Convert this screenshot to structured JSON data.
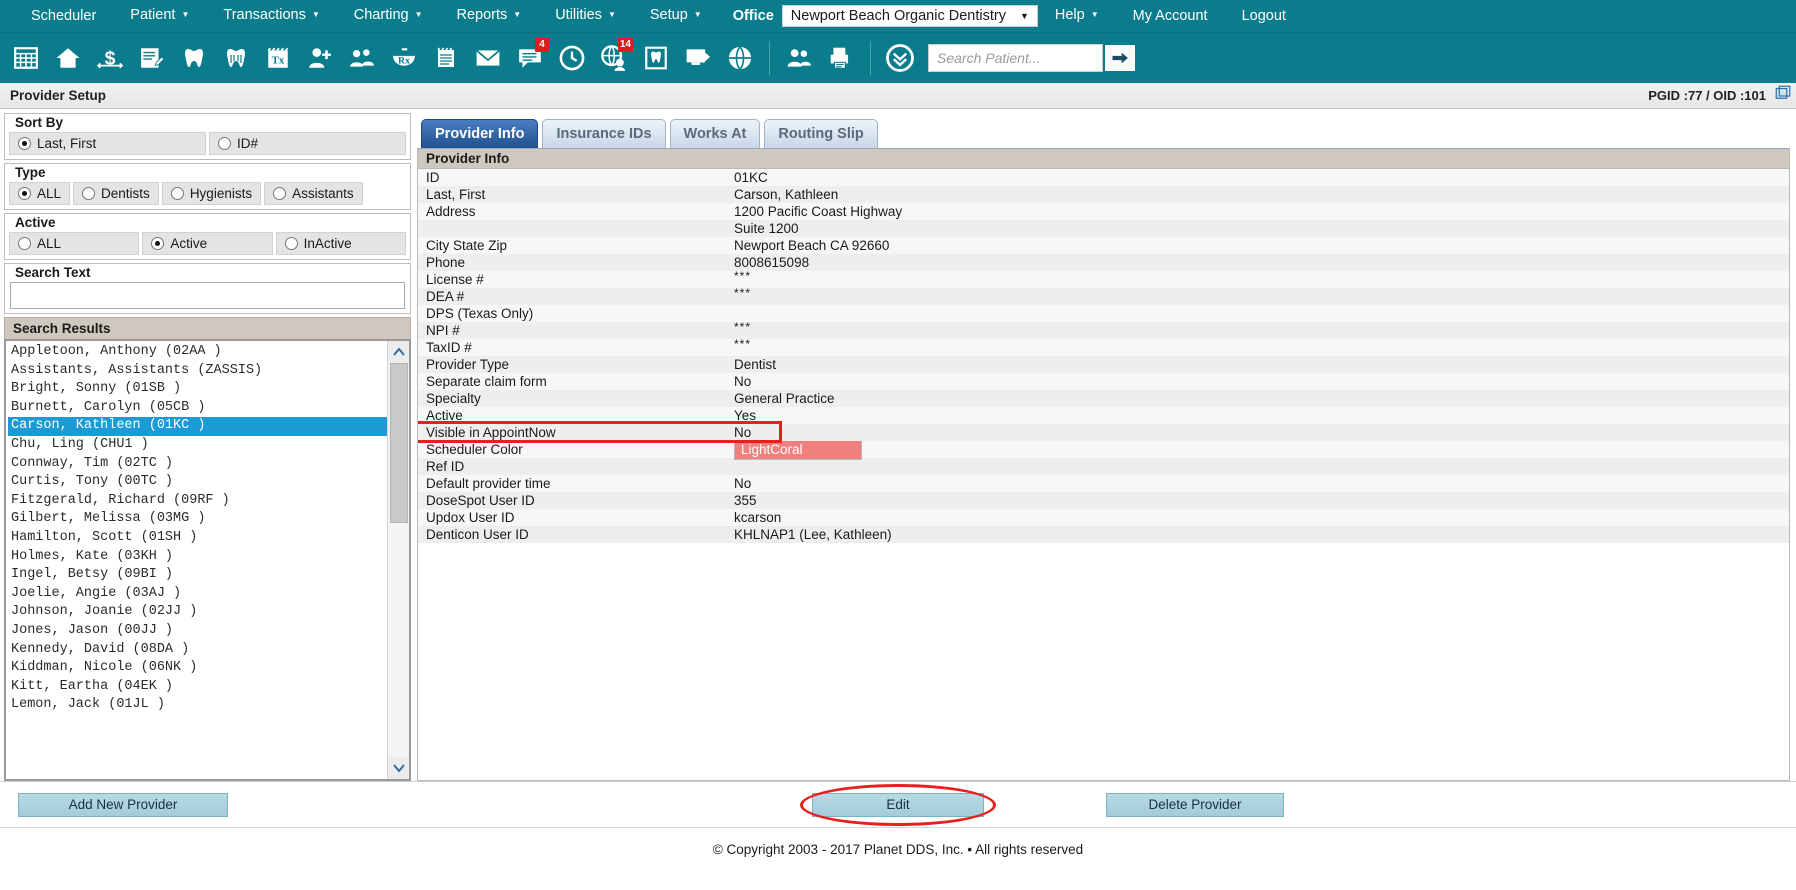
{
  "menu": {
    "items": [
      {
        "label": "Scheduler",
        "has_caret": false
      },
      {
        "label": "Patient",
        "has_caret": true
      },
      {
        "label": "Transactions",
        "has_caret": true
      },
      {
        "label": "Charting",
        "has_caret": true
      },
      {
        "label": "Reports",
        "has_caret": true
      },
      {
        "label": "Utilities",
        "has_caret": true
      },
      {
        "label": "Setup",
        "has_caret": true
      }
    ],
    "office_label": "Office",
    "office_value": "Newport Beach Organic Dentistry",
    "right_items": [
      {
        "label": "Help",
        "has_caret": true
      },
      {
        "label": "My Account",
        "has_caret": false
      },
      {
        "label": "Logout",
        "has_caret": false
      }
    ]
  },
  "toolbar": {
    "icons": [
      {
        "name": "calendar-grid-icon",
        "badge": ""
      },
      {
        "name": "home-icon",
        "badge": ""
      },
      {
        "name": "dollar-ledger-icon",
        "badge": ""
      },
      {
        "name": "notes-edit-icon",
        "badge": ""
      },
      {
        "name": "tooth-icon",
        "badge": ""
      },
      {
        "name": "tooth-perio-icon",
        "badge": ""
      },
      {
        "name": "treatment-plan-icon",
        "badge": ""
      },
      {
        "name": "add-patient-icon",
        "badge": ""
      },
      {
        "name": "family-group-icon",
        "badge": ""
      },
      {
        "name": "prescription-rx-icon",
        "badge": ""
      },
      {
        "name": "clipboard-notepad-icon",
        "badge": ""
      },
      {
        "name": "envelope-mail-icon",
        "badge": ""
      },
      {
        "name": "chat-messages-icon",
        "badge": "4"
      },
      {
        "name": "clock-icon",
        "badge": ""
      },
      {
        "name": "patient-globe-icon",
        "badge": "14"
      },
      {
        "name": "tooth-chart-icon",
        "badge": ""
      },
      {
        "name": "screen-export-icon",
        "badge": ""
      },
      {
        "name": "globe-web-icon",
        "badge": ""
      },
      {
        "name": "users-group-icon",
        "badge": ""
      },
      {
        "name": "print-report-icon",
        "badge": ""
      },
      {
        "name": "double-chevron-down-icon",
        "badge": ""
      }
    ],
    "search_placeholder": "Search Patient...",
    "search_value": "",
    "go_icon": "arrow-right-icon"
  },
  "page": {
    "title": "Provider Setup",
    "pgid_text": "PGID :77  /  OID :101"
  },
  "filters": {
    "sort_by": {
      "legend": "Sort By",
      "options": [
        {
          "label": "Last, First",
          "selected": true
        },
        {
          "label": "ID#",
          "selected": false
        }
      ]
    },
    "type": {
      "legend": "Type",
      "options": [
        {
          "label": "ALL",
          "selected": true
        },
        {
          "label": "Dentists",
          "selected": false
        },
        {
          "label": "Hygienists",
          "selected": false
        },
        {
          "label": "Assistants",
          "selected": false
        }
      ]
    },
    "active": {
      "legend": "Active",
      "options": [
        {
          "label": "ALL",
          "selected": false
        },
        {
          "label": "Active",
          "selected": true
        },
        {
          "label": "InActive",
          "selected": false
        }
      ]
    },
    "search_text": {
      "legend": "Search Text",
      "value": "",
      "placeholder": ""
    }
  },
  "results": {
    "header": "Search Results",
    "items": [
      {
        "text": "Appletoon, Anthony (02AA )",
        "selected": false
      },
      {
        "text": "Assistants, Assistants (ZASSIS)",
        "selected": false
      },
      {
        "text": "Bright, Sonny (01SB )",
        "selected": false
      },
      {
        "text": "Burnett, Carolyn (05CB )",
        "selected": false
      },
      {
        "text": "Carson, Kathleen (01KC )",
        "selected": true
      },
      {
        "text": "Chu, Ling (CHU1 )",
        "selected": false
      },
      {
        "text": "Connway, Tim (02TC )",
        "selected": false
      },
      {
        "text": "Curtis, Tony (00TC )",
        "selected": false
      },
      {
        "text": "Fitzgerald, Richard (09RF )",
        "selected": false
      },
      {
        "text": "Gilbert, Melissa (03MG )",
        "selected": false
      },
      {
        "text": "Hamilton, Scott (01SH )",
        "selected": false
      },
      {
        "text": "Holmes, Kate (03KH )",
        "selected": false
      },
      {
        "text": "Ingel, Betsy (09BI )",
        "selected": false
      },
      {
        "text": "Joelie, Angie (03AJ )",
        "selected": false
      },
      {
        "text": "Johnson, Joanie (02JJ )",
        "selected": false
      },
      {
        "text": "Jones, Jason (00JJ )",
        "selected": false
      },
      {
        "text": "Kennedy, David (08DA )",
        "selected": false
      },
      {
        "text": "Kiddman, Nicole (06NK )",
        "selected": false
      },
      {
        "text": "Kitt, Eartha (04EK )",
        "selected": false
      },
      {
        "text": "Lemon, Jack (01JL )",
        "selected": false
      }
    ]
  },
  "tabs": [
    {
      "label": "Provider Info",
      "active": true
    },
    {
      "label": "Insurance IDs",
      "active": false
    },
    {
      "label": "Works At",
      "active": false
    },
    {
      "label": "Routing Slip",
      "active": false
    }
  ],
  "provider_info": {
    "section_title": "Provider Info",
    "rows": [
      {
        "label": "ID",
        "value": "01KC",
        "type": "text"
      },
      {
        "label": "Last, First",
        "value": "Carson, Kathleen",
        "type": "text"
      },
      {
        "label": "Address",
        "value": "1200 Pacific Coast Highway",
        "type": "text"
      },
      {
        "label": "",
        "value": "Suite 1200",
        "type": "text"
      },
      {
        "label": "City State Zip",
        "value": "Newport Beach CA 92660",
        "type": "text"
      },
      {
        "label": "Phone",
        "value": "8008615098",
        "type": "text"
      },
      {
        "label": "License #",
        "value": "***",
        "type": "masked"
      },
      {
        "label": "DEA #",
        "value": "***",
        "type": "masked"
      },
      {
        "label": "DPS (Texas Only)",
        "value": "",
        "type": "text"
      },
      {
        "label": "NPI #",
        "value": "***",
        "type": "masked"
      },
      {
        "label": "TaxID #",
        "value": "***",
        "type": "masked"
      },
      {
        "label": "Provider Type",
        "value": "Dentist",
        "type": "text"
      },
      {
        "label": "Separate claim form",
        "value": "No",
        "type": "text"
      },
      {
        "label": "Specialty",
        "value": "General Practice",
        "type": "text"
      },
      {
        "label": "Active",
        "value": "Yes",
        "type": "text"
      },
      {
        "label": "Visible in AppointNow",
        "value": "No",
        "type": "text"
      },
      {
        "label": "Scheduler Color",
        "value": "LightCoral",
        "type": "color",
        "color": "#f08080"
      },
      {
        "label": "Ref ID",
        "value": "",
        "type": "text"
      },
      {
        "label": "Default provider time",
        "value": "No",
        "type": "text"
      },
      {
        "label": "DoseSpot User ID",
        "value": "355",
        "type": "text"
      },
      {
        "label": "Updox User ID",
        "value": "kcarson",
        "type": "text"
      },
      {
        "label": "Denticon User ID",
        "value": "KHLNAP1 (Lee, Kathleen)",
        "type": "text"
      }
    ]
  },
  "buttons": {
    "add_new_provider": "Add New Provider",
    "edit": "Edit",
    "delete_provider": "Delete Provider"
  },
  "footer": {
    "copyright": "© Copyright 2003 - 2017 Planet DDS, Inc. • All rights reserved"
  },
  "annotations": {
    "highlight_row_label": "Visible in AppointNow",
    "highlight_button_label": "Edit",
    "color": "#e81f1f"
  }
}
